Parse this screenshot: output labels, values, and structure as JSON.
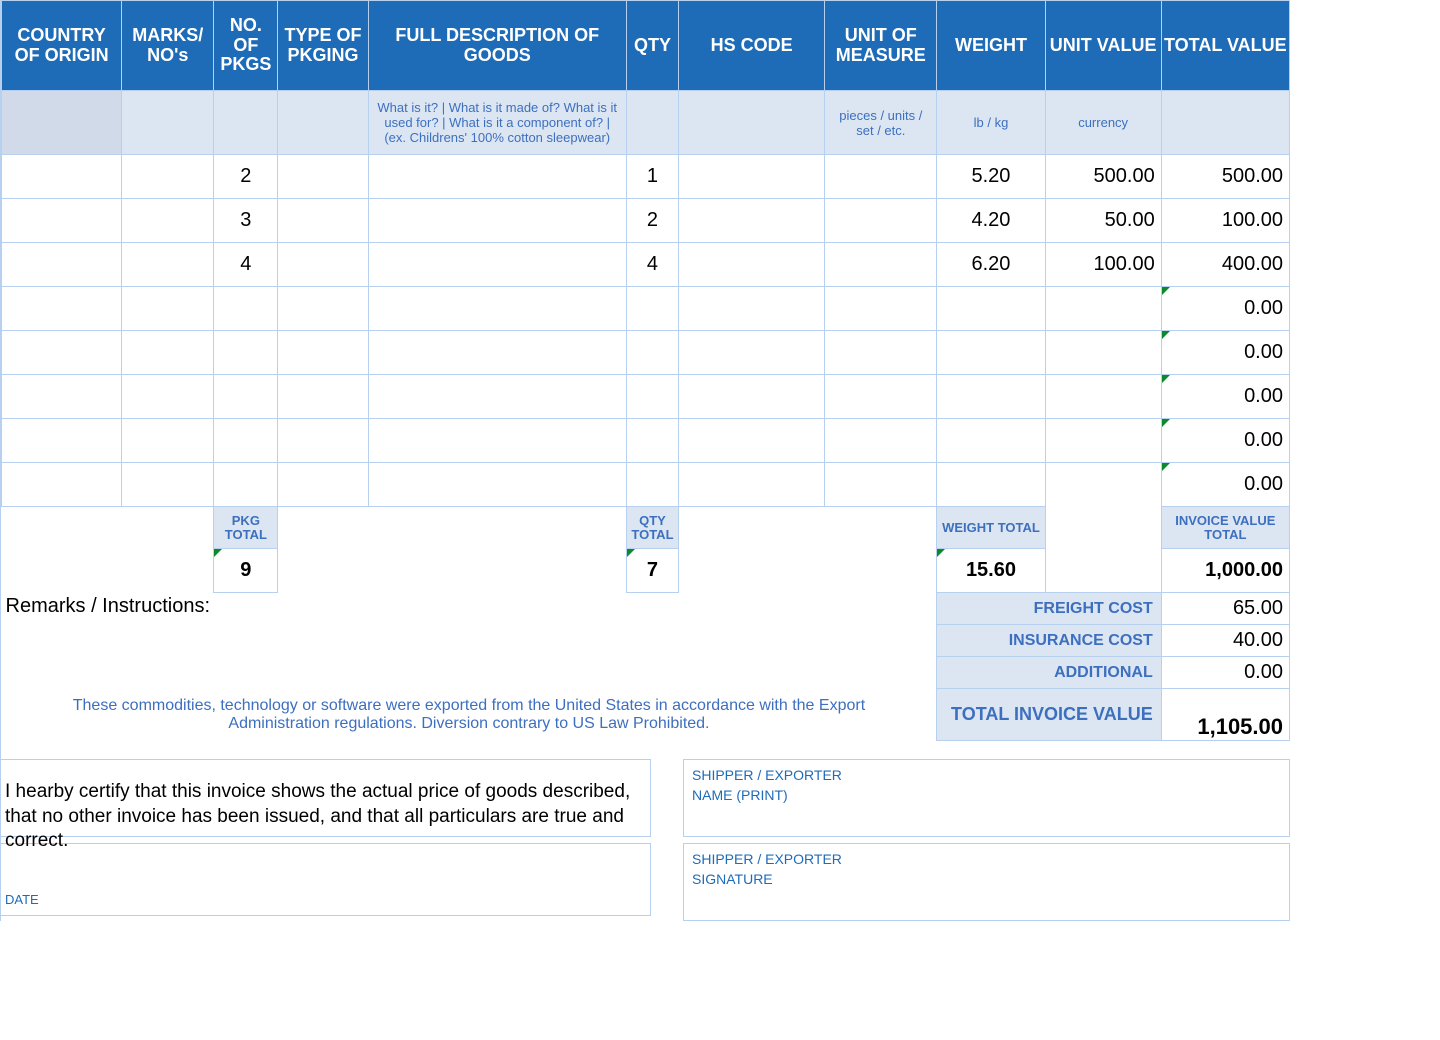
{
  "headers": {
    "h1": "COUNTRY OF ORIGIN",
    "h2": "MARKS/\nNO's",
    "h3": "NO. OF PKGS",
    "h4": "TYPE OF PKGING",
    "h5": "FULL DESCRIPTION OF GOODS",
    "h6": "QTY",
    "h7": "HS CODE",
    "h8": "UNIT OF MEASURE",
    "h9": "WEIGHT",
    "h10": "UNIT VALUE",
    "h11": "TOTAL VALUE"
  },
  "hints": {
    "desc": "What is it? | What is it made of? What is it used for? | What is it a component of? | (ex. Childrens' 100% cotton sleepwear)",
    "uom": "pieces / units / set / etc.",
    "weight": "lb / kg",
    "uv": "currency"
  },
  "rows": [
    {
      "pkgs": "2",
      "qty": "1",
      "weight": "5.20",
      "uv": "500.00",
      "tv": "500.00"
    },
    {
      "pkgs": "3",
      "qty": "2",
      "weight": "4.20",
      "uv": "50.00",
      "tv": "100.00"
    },
    {
      "pkgs": "4",
      "qty": "4",
      "weight": "6.20",
      "uv": "100.00",
      "tv": "400.00"
    },
    {
      "tv": "0.00"
    },
    {
      "tv": "0.00"
    },
    {
      "tv": "0.00"
    },
    {
      "tv": "0.00"
    },
    {
      "tv": "0.00"
    }
  ],
  "totals": {
    "pkg_label": "PKG TOTAL",
    "qty_label": "QTY TOTAL",
    "weight_label": "WEIGHT TOTAL",
    "inv_label": "INVOICE VALUE TOTAL",
    "pkg": "9",
    "qty": "7",
    "weight": "15.60",
    "inv": "1,000.00"
  },
  "costs": {
    "freight_label": "FREIGHT COST",
    "insurance_label": "INSURANCE COST",
    "additional_label": "ADDITIONAL",
    "total_label": "TOTAL INVOICE VALUE",
    "freight": "65.00",
    "insurance": "40.00",
    "additional": "0.00",
    "total": "1,105.00"
  },
  "labels": {
    "remarks": "Remarks / Instructions:",
    "disclaimer": "These commodities, technology or software were exported from the United States in accordance with the Export Administration regulations.  Diversion contrary to US Law Prohibited.",
    "certify": "I hearby certify that this invoice shows the actual price of goods described, that no other invoice has been issued, and that all particulars are true and correct.",
    "date": "DATE",
    "shipper_name_1": "SHIPPER / EXPORTER",
    "shipper_name_2": "NAME (PRINT)",
    "shipper_sig_1": "SHIPPER / EXPORTER",
    "shipper_sig_2": "SIGNATURE"
  },
  "chart_data": {
    "type": "table",
    "columns": [
      "COUNTRY OF ORIGIN",
      "MARKS/NO's",
      "NO. OF PKGS",
      "TYPE OF PKGING",
      "FULL DESCRIPTION OF GOODS",
      "QTY",
      "HS CODE",
      "UNIT OF MEASURE",
      "WEIGHT",
      "UNIT VALUE",
      "TOTAL VALUE"
    ],
    "rows": [
      [
        "",
        "",
        2,
        "",
        "",
        1,
        "",
        "",
        5.2,
        500.0,
        500.0
      ],
      [
        "",
        "",
        3,
        "",
        "",
        2,
        "",
        "",
        4.2,
        50.0,
        100.0
      ],
      [
        "",
        "",
        4,
        "",
        "",
        4,
        "",
        "",
        6.2,
        100.0,
        400.0
      ],
      [
        "",
        "",
        null,
        "",
        "",
        null,
        "",
        "",
        null,
        null,
        0.0
      ],
      [
        "",
        "",
        null,
        "",
        "",
        null,
        "",
        "",
        null,
        null,
        0.0
      ],
      [
        "",
        "",
        null,
        "",
        "",
        null,
        "",
        "",
        null,
        null,
        0.0
      ],
      [
        "",
        "",
        null,
        "",
        "",
        null,
        "",
        "",
        null,
        null,
        0.0
      ],
      [
        "",
        "",
        null,
        "",
        "",
        null,
        "",
        "",
        null,
        null,
        0.0
      ]
    ],
    "totals": {
      "pkgs": 9,
      "qty": 7,
      "weight": 15.6,
      "invoice_value": 1000.0
    },
    "summary": {
      "freight": 65.0,
      "insurance": 40.0,
      "additional": 0.0,
      "total_invoice_value": 1105.0
    }
  }
}
